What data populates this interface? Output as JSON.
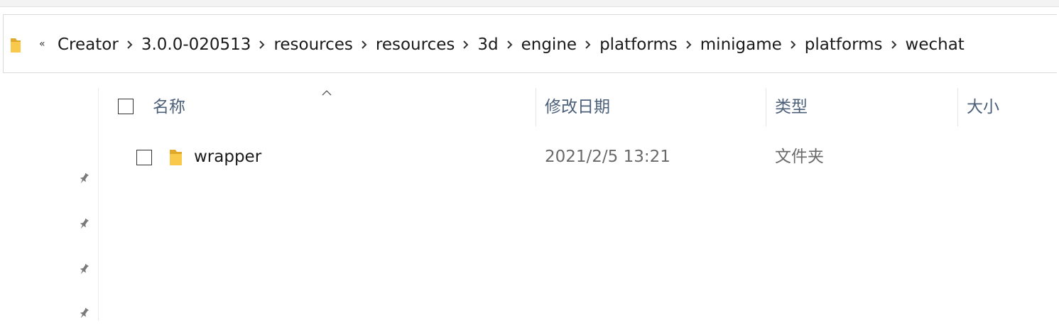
{
  "address_bar": {
    "overflow": "«",
    "crumbs": [
      "Creator",
      "3.0.0-020513",
      "resources",
      "resources",
      "3d",
      "engine",
      "platforms",
      "minigame",
      "platforms",
      "wechat"
    ]
  },
  "columns": {
    "name": "名称",
    "date_modified": "修改日期",
    "type": "类型",
    "size": "大小"
  },
  "files": [
    {
      "name": "wrapper",
      "date_modified": "2021/2/5 13:21",
      "type": "文件夹",
      "size": ""
    }
  ],
  "icons": {
    "folder": "folder-icon",
    "separator": "chevron-right-icon",
    "pin": "pin-icon",
    "sort": "sort-ascending-icon"
  },
  "colors": {
    "header_text": "#4c607a",
    "folder_yellow": "#f8c94a",
    "folder_dark": "#e0a92a"
  }
}
